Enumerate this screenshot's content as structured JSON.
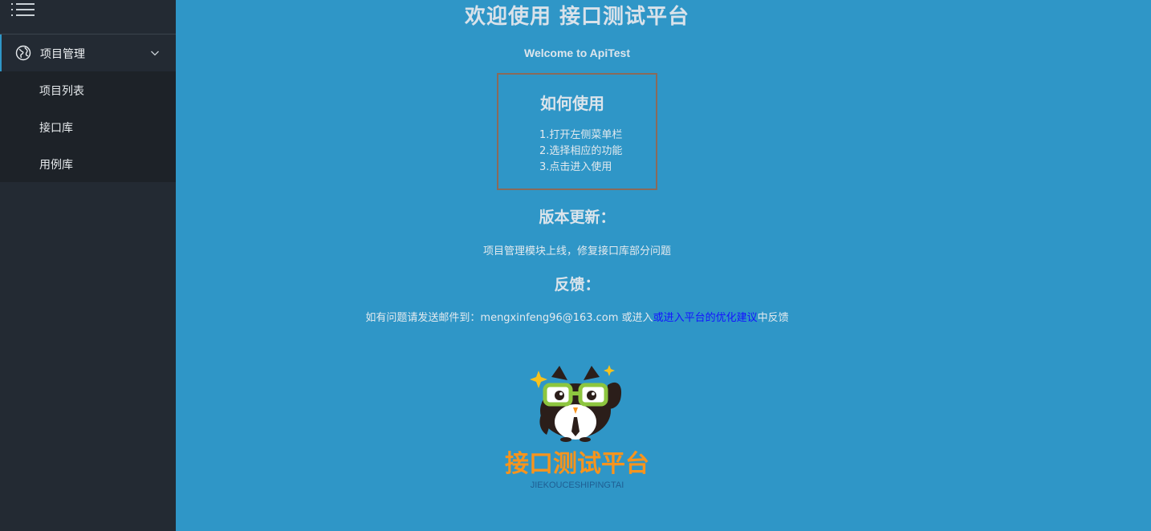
{
  "sidebar": {
    "group_label": "项目管理",
    "items": [
      {
        "label": "项目列表"
      },
      {
        "label": "接口库"
      },
      {
        "label": "用例库"
      }
    ]
  },
  "main": {
    "title": "欢迎使用 接口测试平台",
    "subtitle": "Welcome to ApiTest",
    "howto": {
      "title": "如何使用",
      "steps": [
        "1.打开左侧菜单栏",
        "2.选择相应的功能",
        "3.点击进入使用"
      ]
    },
    "version": {
      "heading": "版本更新：",
      "text": "项目管理模块上线，修复接口库部分问题"
    },
    "feedback": {
      "heading": "反馈：",
      "text_before": "如有问题请发送邮件到：mengxinfeng96@163.com 或进入",
      "link": "或进入平台的优化建议",
      "text_after": "中反馈"
    },
    "logo": {
      "title": "接口测试平台",
      "subtitle": "JIEKOUCESHIPINGTAI"
    }
  },
  "colors": {
    "background": "#2f96c7",
    "sidebar": "#232a33",
    "submenu": "#1d2228",
    "link": "#1414ff",
    "logo_orange": "#f7941d",
    "glasses_green": "#8dc63f"
  },
  "icons": [
    "menu-icon",
    "globe-icon",
    "chevron-down-icon",
    "owl-mascot"
  ]
}
